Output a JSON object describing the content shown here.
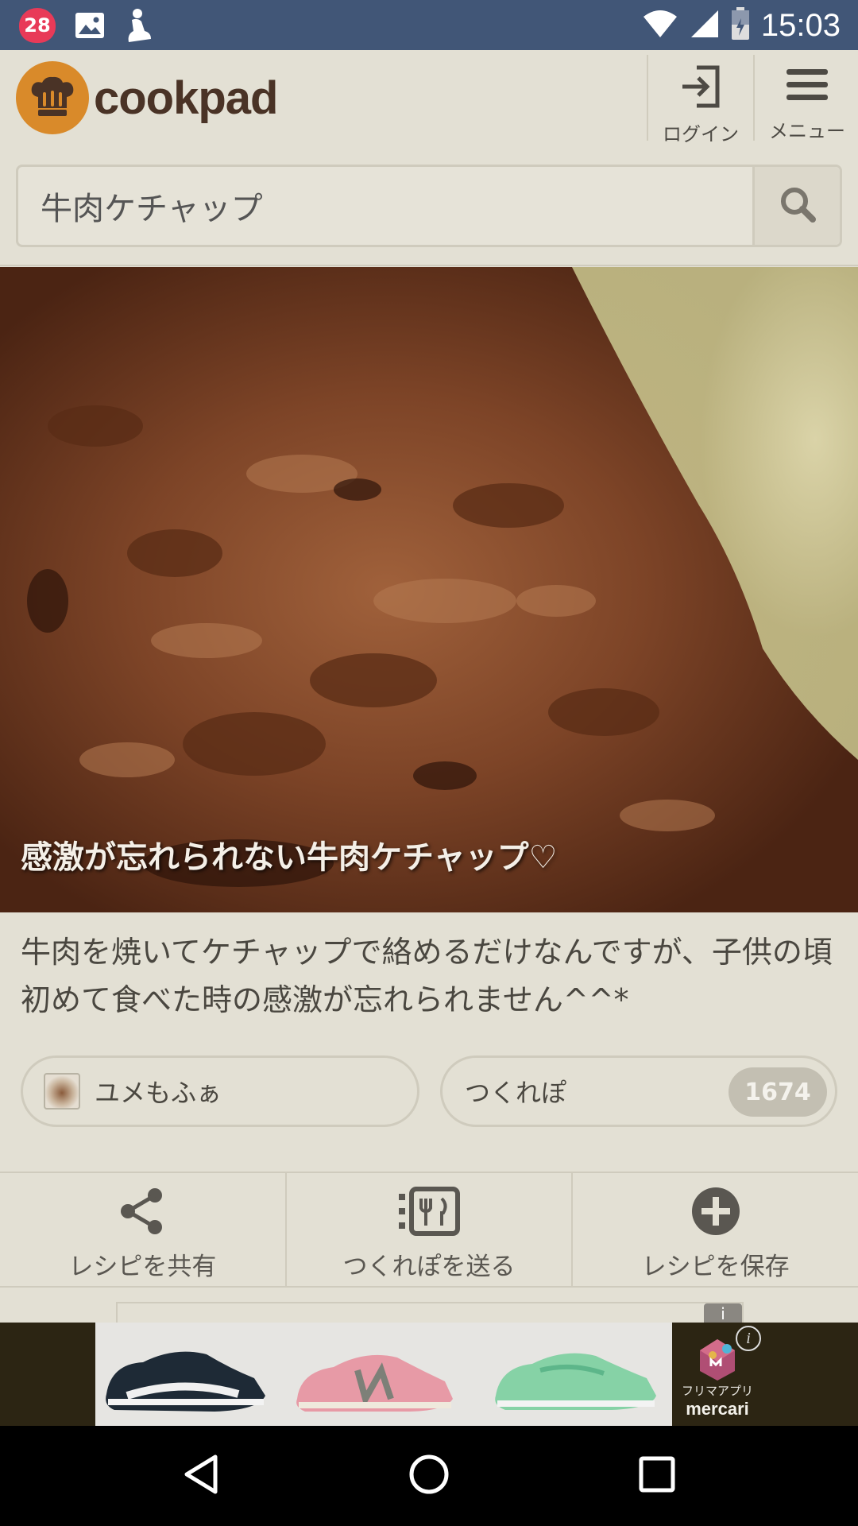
{
  "status_bar": {
    "notification_count": "28",
    "time": "15:03"
  },
  "header": {
    "brand": "cookpad",
    "login_label": "ログイン",
    "menu_label": "メニュー"
  },
  "search": {
    "value": "牛肉ケチャップ"
  },
  "recipe": {
    "title": "感激が忘れられない牛肉ケチャップ♡",
    "description": "牛肉を焼いてケチャップで絡めるだけなんですが、子供の頃初めて食べた時の感激が忘れられません^^*",
    "author": "ユメもふぁ",
    "tsukurepo_label": "つくれぽ",
    "tsukurepo_count": "1674"
  },
  "actions": [
    {
      "label": "レシピを共有",
      "icon": "share-icon"
    },
    {
      "label": "つくれぽを送る",
      "icon": "tsukurepo-icon"
    },
    {
      "label": "レシピを保存",
      "icon": "add-icon"
    }
  ],
  "ad": {
    "brand_line1": "フリマアプリ",
    "brand_line2": "mercari",
    "info_symbol": "i"
  },
  "colors": {
    "status_bar": "#415677",
    "background": "#e3e0d4",
    "logo_orange": "#d98a2a"
  }
}
